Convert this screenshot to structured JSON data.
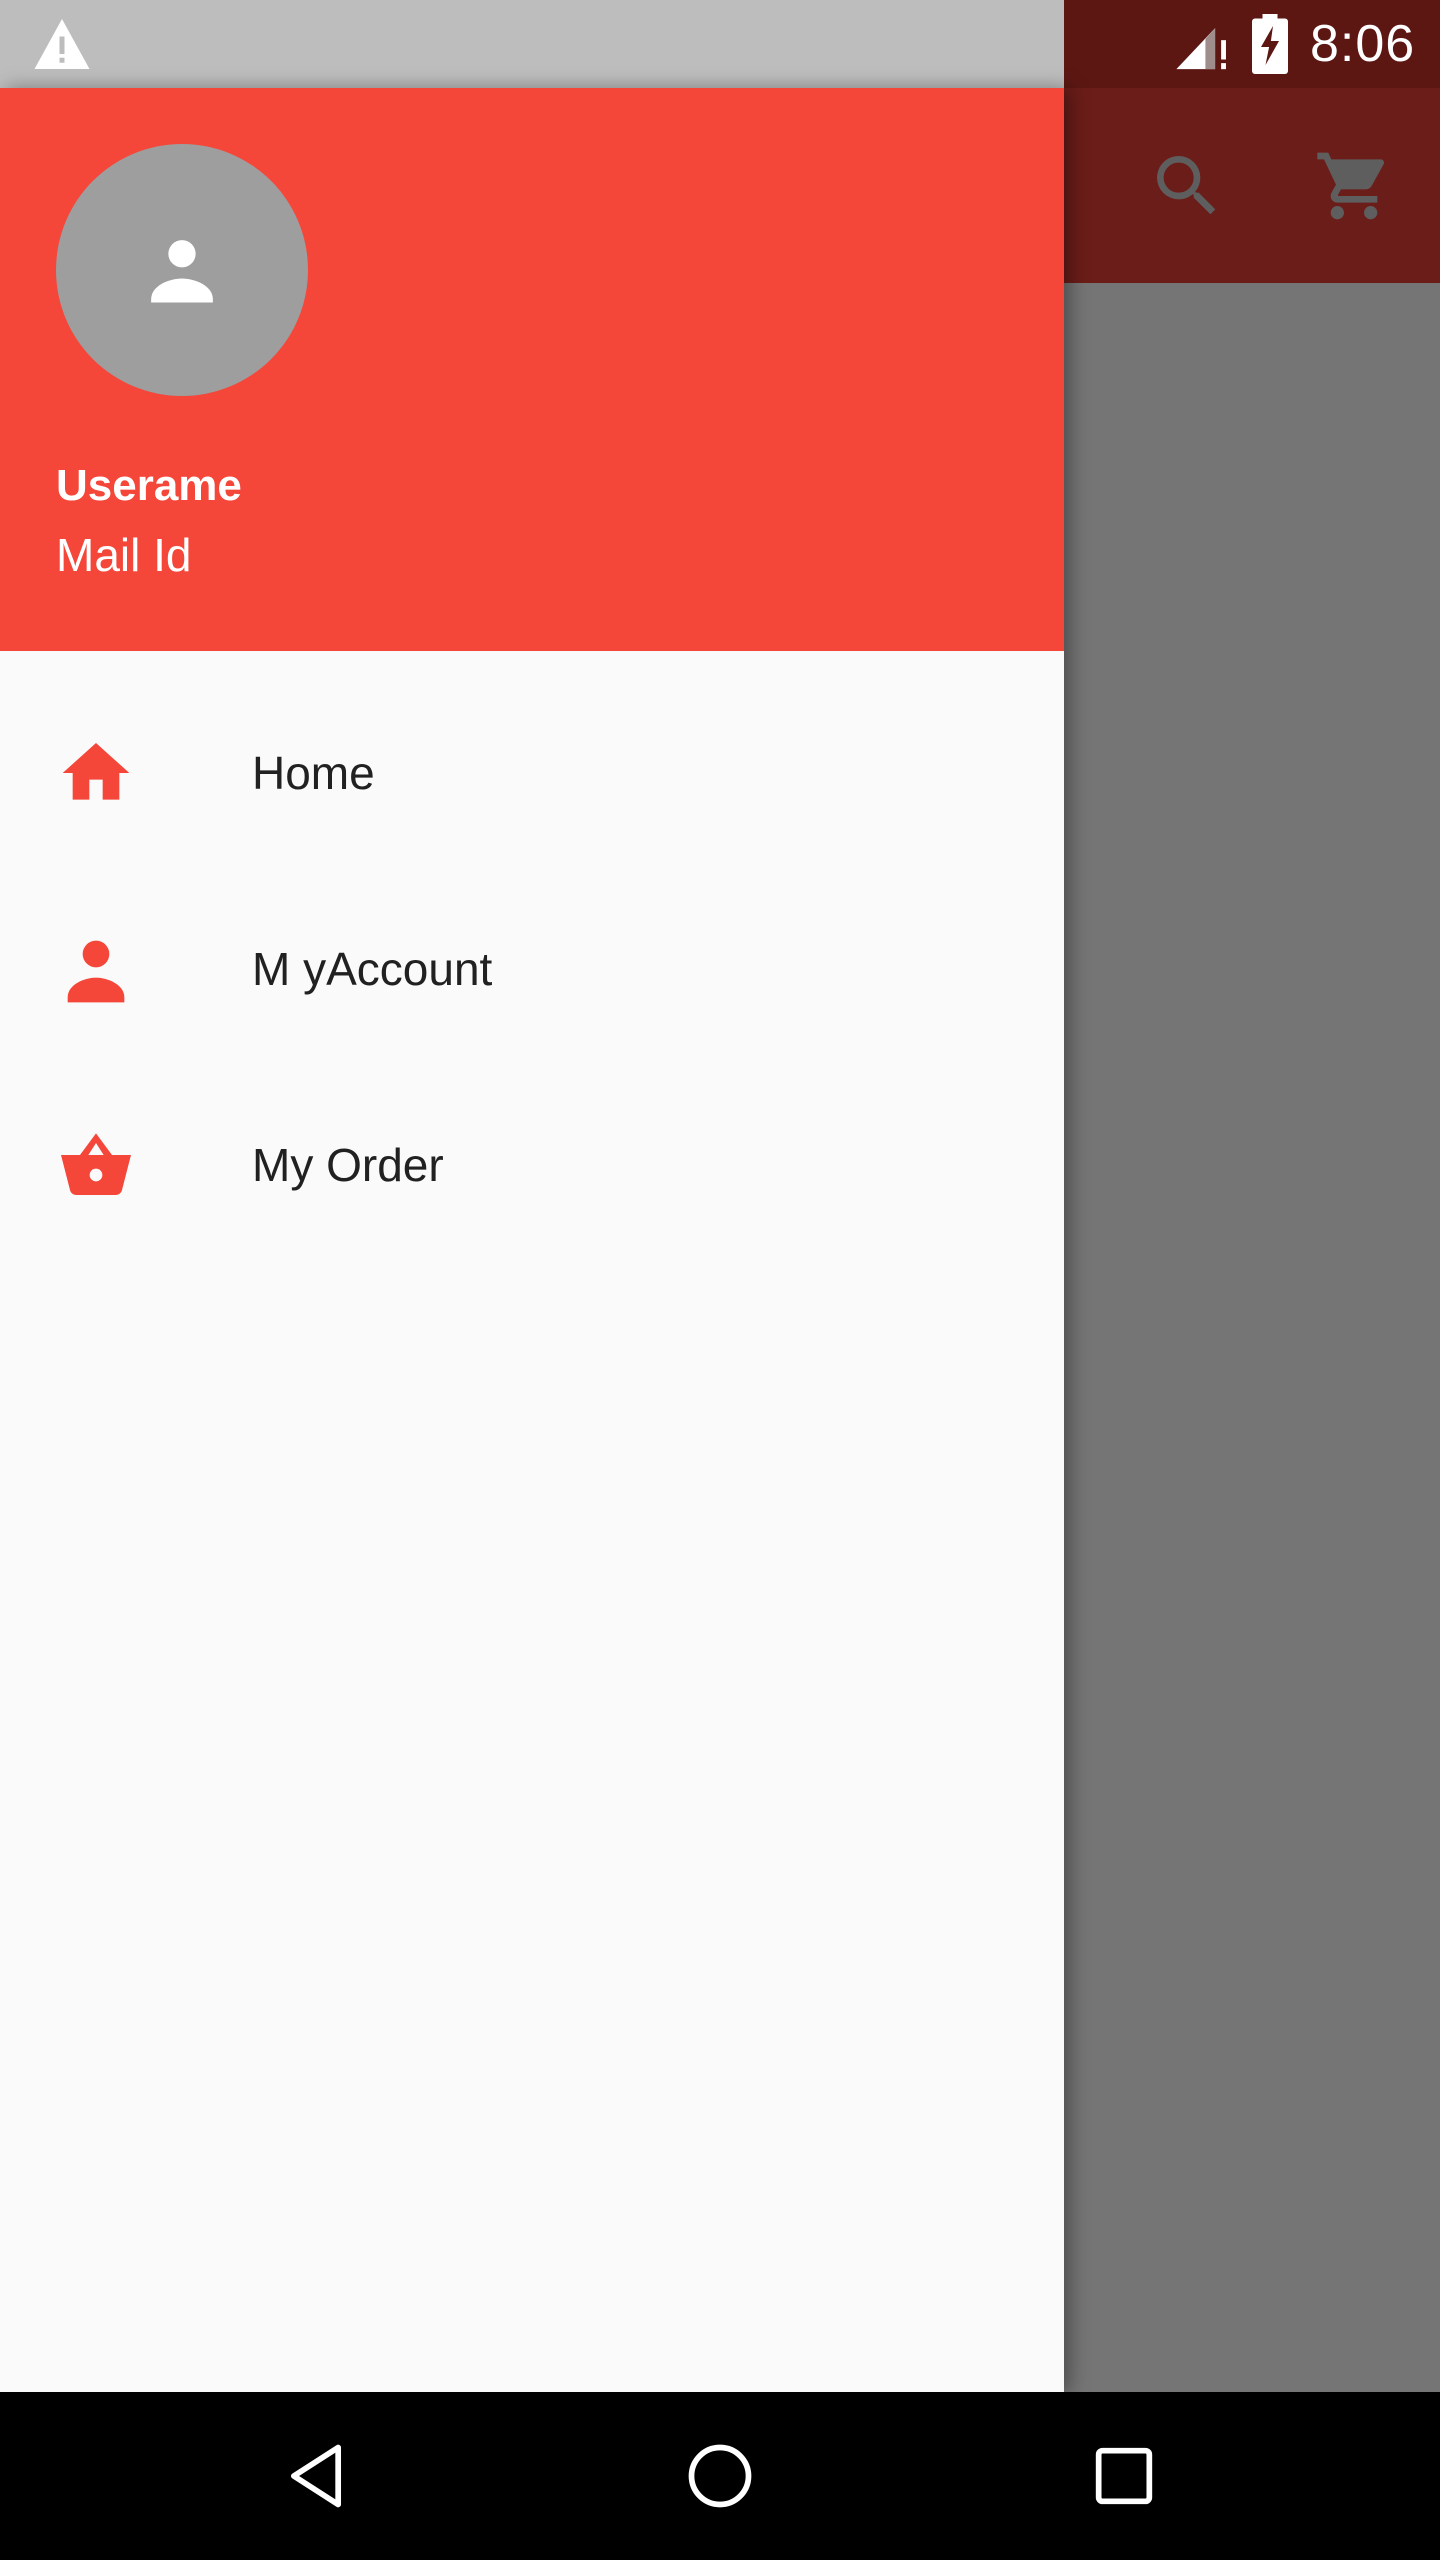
{
  "status_bar": {
    "time": "8:06",
    "left_icon": "warning-icon",
    "right_icons": [
      "signal-icon",
      "battery-charging-icon"
    ]
  },
  "app_bar": {
    "actions": [
      "search-icon",
      "cart-icon"
    ]
  },
  "drawer": {
    "header": {
      "avatar_icon": "person-icon",
      "username": "Userame",
      "mail": "Mail Id"
    },
    "items": [
      {
        "label": "Home",
        "icon": "home-icon"
      },
      {
        "label": "M yAccount",
        "icon": "person-icon"
      },
      {
        "label": "My Order",
        "icon": "basket-icon"
      }
    ]
  },
  "nav_bar": {
    "buttons": [
      "back-icon",
      "home-circle-icon",
      "recents-icon"
    ]
  },
  "colors": {
    "accent": "#f44639",
    "drawer_background": "#fafafa",
    "scrim": "#757575",
    "app_bar_dimmed": "#6b1d19",
    "status_bar_left": "#bdbdbd",
    "status_bar_right": "#5c1713",
    "text_primary": "#212121"
  }
}
